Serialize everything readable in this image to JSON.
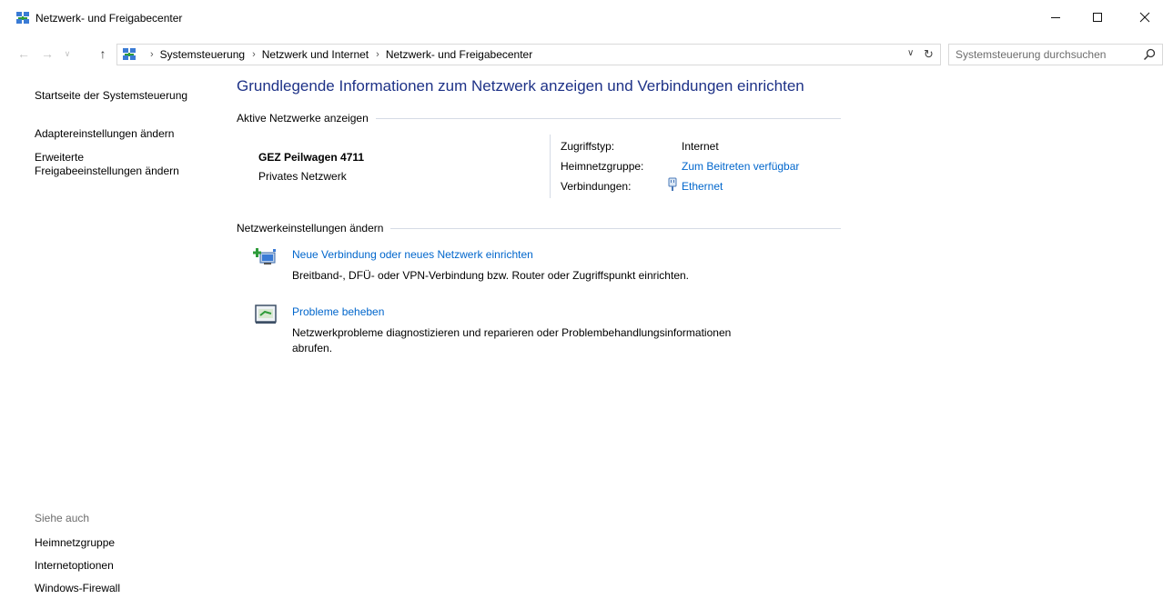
{
  "window": {
    "title": "Netzwerk- und Freigabecenter"
  },
  "address": {
    "crumbs": [
      "Systemsteuerung",
      "Netzwerk und Internet",
      "Netzwerk- und Freigabecenter"
    ]
  },
  "search": {
    "placeholder": "Systemsteuerung durchsuchen"
  },
  "sidebar": {
    "links": [
      {
        "label": "Startseite der Systemsteuerung"
      },
      {
        "label": "Adaptereinstellungen ändern"
      },
      {
        "label": "Erweiterte Freigabeeinstellungen ändern",
        "line1": "Erweiterte",
        "line2": "Freigabeeinstellungen ändern"
      }
    ],
    "see_also_label": "Siehe auch",
    "see_also": [
      {
        "label": "Heimnetzgruppe"
      },
      {
        "label": "Internetoptionen"
      },
      {
        "label": "Windows-Firewall"
      }
    ]
  },
  "main": {
    "title": "Grundlegende Informationen zum Netzwerk anzeigen und Verbindungen einrichten",
    "active_section": "Aktive Netzwerke anzeigen",
    "network": {
      "name": "GEZ Peilwagen 4711",
      "type": "Privates Netzwerk",
      "access_label": "Zugriffstyp:",
      "access_value": "Internet",
      "homegroup_label": "Heimnetzgruppe:",
      "homegroup_value": "Zum Beitreten verfügbar",
      "connections_label": "Verbindungen:",
      "connections_value": "Ethernet"
    },
    "settings_section": "Netzwerkeinstellungen ändern",
    "tasks": [
      {
        "title": "Neue Verbindung oder neues Netzwerk einrichten",
        "desc": "Breitband-, DFÜ- oder VPN-Verbindung bzw. Router oder Zugriffspunkt einrichten."
      },
      {
        "title": "Probleme beheben",
        "desc": "Netzwerkprobleme diagnostizieren und reparieren oder Problembehandlungsinformationen abrufen.",
        "desc_line1": "Netzwerkprobleme diagnostizieren und reparieren oder Problembehandlungsinformationen",
        "desc_line2": "abrufen."
      }
    ]
  },
  "colors": {
    "title_blue": "#1e3287",
    "link_blue": "#0066cc",
    "divider": "#d5dbe5"
  }
}
